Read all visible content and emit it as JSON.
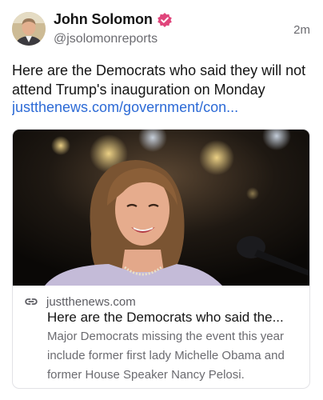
{
  "author": {
    "display_name": "John Solomon",
    "handle": "@jsolomonreports",
    "avatar_icon": "avatar-photo",
    "verified_icon": "verified-badge-icon",
    "verified_color": "#e0457b"
  },
  "timestamp": "2m",
  "post": {
    "text": "Here are the Democrats who said they will not attend Trump's inauguration on Monday",
    "link_text": "justthenews.com/government/con...",
    "link_color": "#2c6ad6"
  },
  "card": {
    "image_icon": "woman-speaking-photo",
    "domain_icon": "link-icon",
    "domain": "justthenews.com",
    "title": "Here are the Democrats who said the...",
    "description": "Major Democrats missing the event this year include former first lady Michelle Obama and former House Speaker Nancy Pelosi."
  }
}
